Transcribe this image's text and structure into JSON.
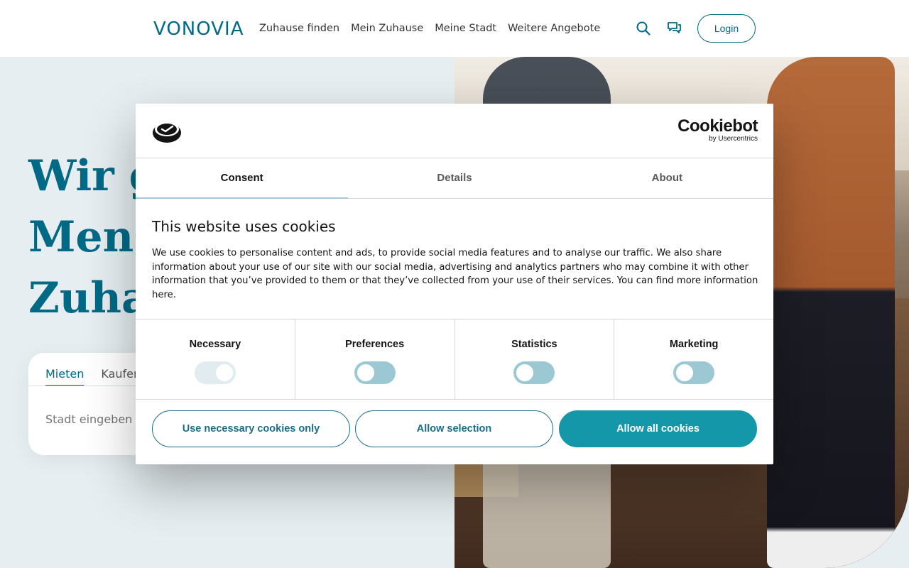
{
  "header": {
    "logo_text": "VONOVIA",
    "nav": [
      "Zuhause finden",
      "Mein Zuhause",
      "Meine Stadt",
      "Weitere Angebote"
    ],
    "login_label": "Login",
    "icons": {
      "search": "search-icon",
      "chat": "chat-icon"
    }
  },
  "hero": {
    "title_line1": "Wir g",
    "title_line2": "Mens",
    "title_line3": "Zuha",
    "tabs": [
      "Mieten",
      "Kaufen"
    ],
    "search_placeholder": "Stadt eingeben"
  },
  "cookie_dialog": {
    "brand_name": "Cookiebot",
    "brand_sub": "by Usercentrics",
    "tabs": [
      "Consent",
      "Details",
      "About"
    ],
    "active_tab": "Consent",
    "title": "This website uses cookies",
    "text": "We use cookies to personalise content and ads, to provide social media features and to analyse our traffic. We also share information about your use of our site with our social media, advertising and analytics partners who may combine it with other information that you’ve provided to them or that they’ve collected from your use of their services. You can find more information here.",
    "categories": [
      {
        "label": "Necessary",
        "checked": true,
        "disabled": true
      },
      {
        "label": "Preferences",
        "checked": false,
        "disabled": false
      },
      {
        "label": "Statistics",
        "checked": false,
        "disabled": false
      },
      {
        "label": "Marketing",
        "checked": false,
        "disabled": false
      }
    ],
    "buttons": {
      "necessary_only": "Use necessary cookies only",
      "allow_selection": "Allow selection",
      "allow_all": "Allow all cookies"
    }
  },
  "colors": {
    "brand": "#006a86",
    "hero_bg": "#e6eef1",
    "accent_button": "#1498a9",
    "toggle_off": "#9bc8d2"
  }
}
